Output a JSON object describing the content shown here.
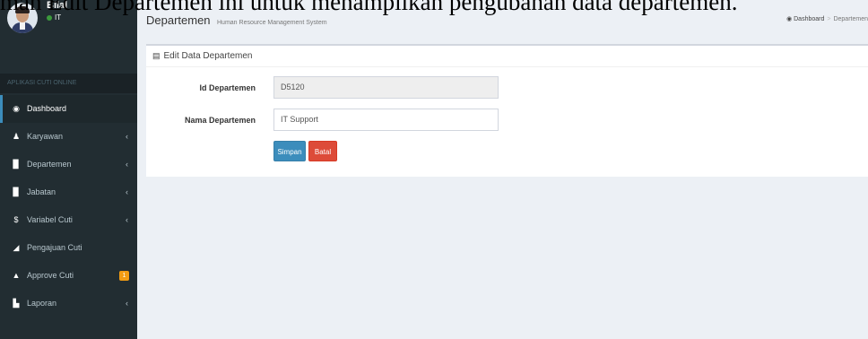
{
  "caption": {
    "text": "man Edit Departemen ini untuk menampilkan pengubahan data departemen."
  },
  "user": {
    "name": "Bilal",
    "status": "IT"
  },
  "sidebar": {
    "header": "APLIKASI CUTI ONLINE",
    "items": [
      {
        "label": "Dashboard",
        "icon": "dashboard-icon",
        "glyph": "◉",
        "active": true,
        "chevron": false
      },
      {
        "label": "Karyawan",
        "icon": "user-icon",
        "glyph": "♟",
        "active": false,
        "chevron": true
      },
      {
        "label": "Departemen",
        "icon": "book-icon",
        "glyph": "▉",
        "active": false,
        "chevron": true
      },
      {
        "label": "Jabatan",
        "icon": "book-icon",
        "glyph": "▉",
        "active": false,
        "chevron": true
      },
      {
        "label": "Variabel Cuti",
        "icon": "dollar-icon",
        "glyph": "$",
        "active": false,
        "chevron": true
      },
      {
        "label": "Pengajuan Cuti",
        "icon": "tag-icon",
        "glyph": "◢",
        "active": false,
        "chevron": false
      },
      {
        "label": "Approve Cuti",
        "icon": "lock-icon",
        "glyph": "▲",
        "active": false,
        "chevron": false,
        "badge": "1"
      },
      {
        "label": "Laporan",
        "icon": "file-icon",
        "glyph": "▙",
        "active": false,
        "chevron": true
      }
    ],
    "chevron_glyph": "‹"
  },
  "header": {
    "title": "Departemen",
    "subtitle": "Human Resource Management System"
  },
  "breadcrumb": {
    "home": "Dashboard",
    "current": "Departemen"
  },
  "box": {
    "title": "Edit Data Departemen"
  },
  "form": {
    "id_label": "Id Departemen",
    "id_value": "D5120",
    "name_label": "Nama Departemen",
    "name_value": "IT Support",
    "save_label": "Simpan",
    "cancel_label": "Batal"
  },
  "colors": {
    "sidebar_bg": "#222d32",
    "content_bg": "#ecf0f5",
    "primary": "#3c8dbc",
    "danger": "#dd4b39",
    "badge": "#f39c12"
  }
}
